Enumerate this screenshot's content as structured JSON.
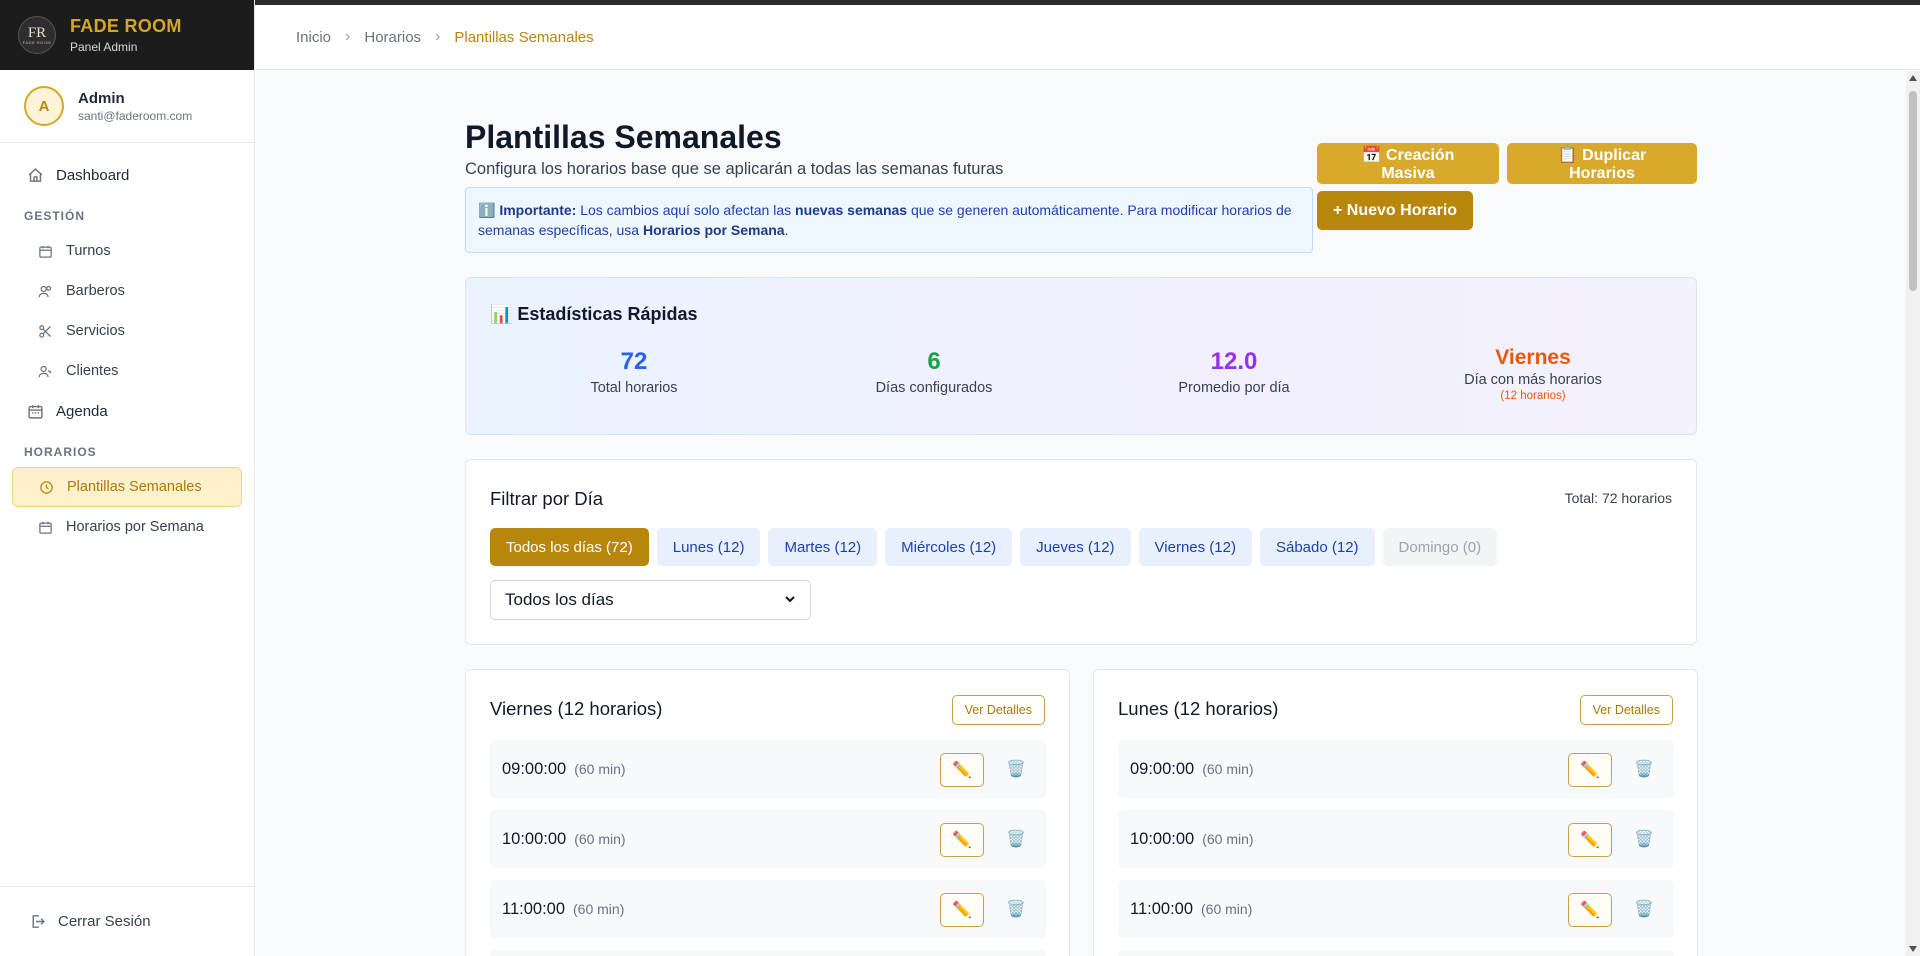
{
  "brand": {
    "logo_text": "FR",
    "logo_sub": "FADE ROOM",
    "name": "FADE ROOM",
    "tagline": "Panel Admin"
  },
  "user": {
    "initial": "A",
    "name": "Admin",
    "email": "santi@faderoom.com"
  },
  "nav": {
    "dashboard": "Dashboard",
    "section_gestion": "GESTIÓN",
    "turnos": "Turnos",
    "barberos": "Barberos",
    "servicios": "Servicios",
    "clientes": "Clientes",
    "agenda": "Agenda",
    "section_horarios": "HORARIOS",
    "plantillas": "Plantillas Semanales",
    "horarios_semana": "Horarios por Semana",
    "logout": "Cerrar Sesión"
  },
  "breadcrumb": [
    "Inicio",
    "Horarios",
    "Plantillas Semanales"
  ],
  "page": {
    "title": "Plantillas Semanales",
    "subtitle": "Configura los horarios base que se aplicarán a todas las semanas futuras"
  },
  "notice": {
    "icon": "ℹ️",
    "label": "Importante:",
    "text1": " Los cambios aquí solo afectan las ",
    "bold1": "nuevas semanas",
    "text2": " que se generen automáticamente. Para modificar horarios de semanas específicas, usa ",
    "bold2": "Horarios por Semana",
    "text3": "."
  },
  "buttons": {
    "masiva": "📅 Creación Masiva",
    "duplicar": "📋 Duplicar Horarios",
    "nuevo": "+ Nuevo Horario"
  },
  "stats": {
    "title": "📊 Estadísticas Rápidas",
    "items": [
      {
        "value": "72",
        "label": "Total horarios",
        "color": "#2563eb"
      },
      {
        "value": "6",
        "label": "Días configurados",
        "color": "#16a34a"
      },
      {
        "value": "12.0",
        "label": "Promedio por día",
        "color": "#9333ea"
      },
      {
        "value": "Viernes",
        "label": "Día con más horarios",
        "note": "(12 horarios)",
        "color": "#ea580c"
      }
    ]
  },
  "filter": {
    "title": "Filtrar por Día",
    "total": "Total: 72 horarios",
    "chips": [
      "Todos los días (72)",
      "Lunes (12)",
      "Martes (12)",
      "Miércoles (12)",
      "Jueves (12)",
      "Viernes (12)",
      "Sábado (12)",
      "Domingo (0)"
    ],
    "select_value": "Todos los días"
  },
  "cards": [
    {
      "title": "Viernes (12 horarios)",
      "button": "Ver Detalles",
      "slots": [
        {
          "time": "09:00:00",
          "duration": "(60 min)"
        },
        {
          "time": "10:00:00",
          "duration": "(60 min)"
        },
        {
          "time": "11:00:00",
          "duration": "(60 min)"
        }
      ]
    },
    {
      "title": "Lunes (12 horarios)",
      "button": "Ver Detalles",
      "slots": [
        {
          "time": "09:00:00",
          "duration": "(60 min)"
        },
        {
          "time": "10:00:00",
          "duration": "(60 min)"
        },
        {
          "time": "11:00:00",
          "duration": "(60 min)"
        }
      ]
    }
  ],
  "icons": {
    "edit": "✏️",
    "delete": "🗑️"
  }
}
